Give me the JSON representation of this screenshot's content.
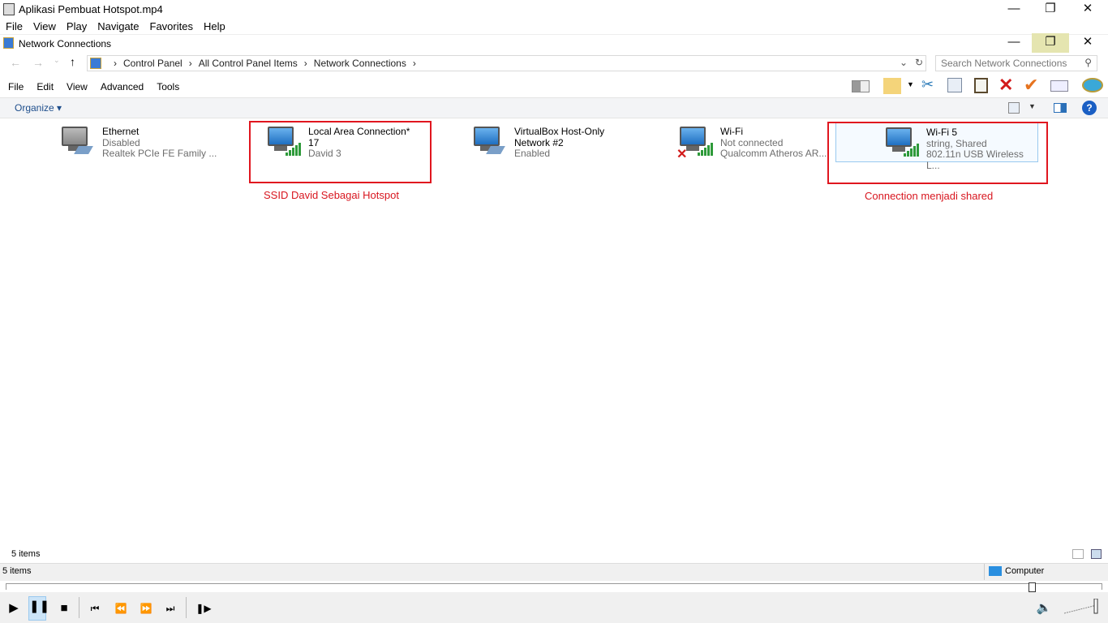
{
  "player": {
    "title": "Aplikasi Pembuat Hotspot.mp4",
    "menu": [
      "File",
      "View",
      "Play",
      "Navigate",
      "Favorites",
      "Help"
    ],
    "seek_progress": 0.94,
    "volume": 1.0,
    "status_left": "5 items",
    "status_right": "Computer"
  },
  "explorer": {
    "title": "Network Connections",
    "breadcrumb": [
      "Control Panel",
      "All Control Panel Items",
      "Network Connections"
    ],
    "search_placeholder": "Search Network Connections",
    "menu": [
      "File",
      "Edit",
      "View",
      "Advanced",
      "Tools"
    ],
    "organize": "Organize",
    "item_count": "5 items",
    "items": [
      {
        "name": "Ethernet",
        "line2": "Disabled",
        "line3": "Realtek PCIe FE Family ..."
      },
      {
        "name": "Local Area Connection*",
        "line2": "17",
        "line3": "David 3"
      },
      {
        "name": "VirtualBox Host-Only",
        "line2": "Network #2",
        "line3": "Enabled"
      },
      {
        "name": "Wi-Fi",
        "line2": "Not connected",
        "line3": "Qualcomm Atheros AR..."
      },
      {
        "name": "Wi-Fi 5",
        "line2": "string, Shared",
        "line3": "802.11n USB Wireless L..."
      }
    ]
  },
  "annotations": [
    "SSID David Sebagai Hotspot",
    "Connection menjadi shared"
  ]
}
